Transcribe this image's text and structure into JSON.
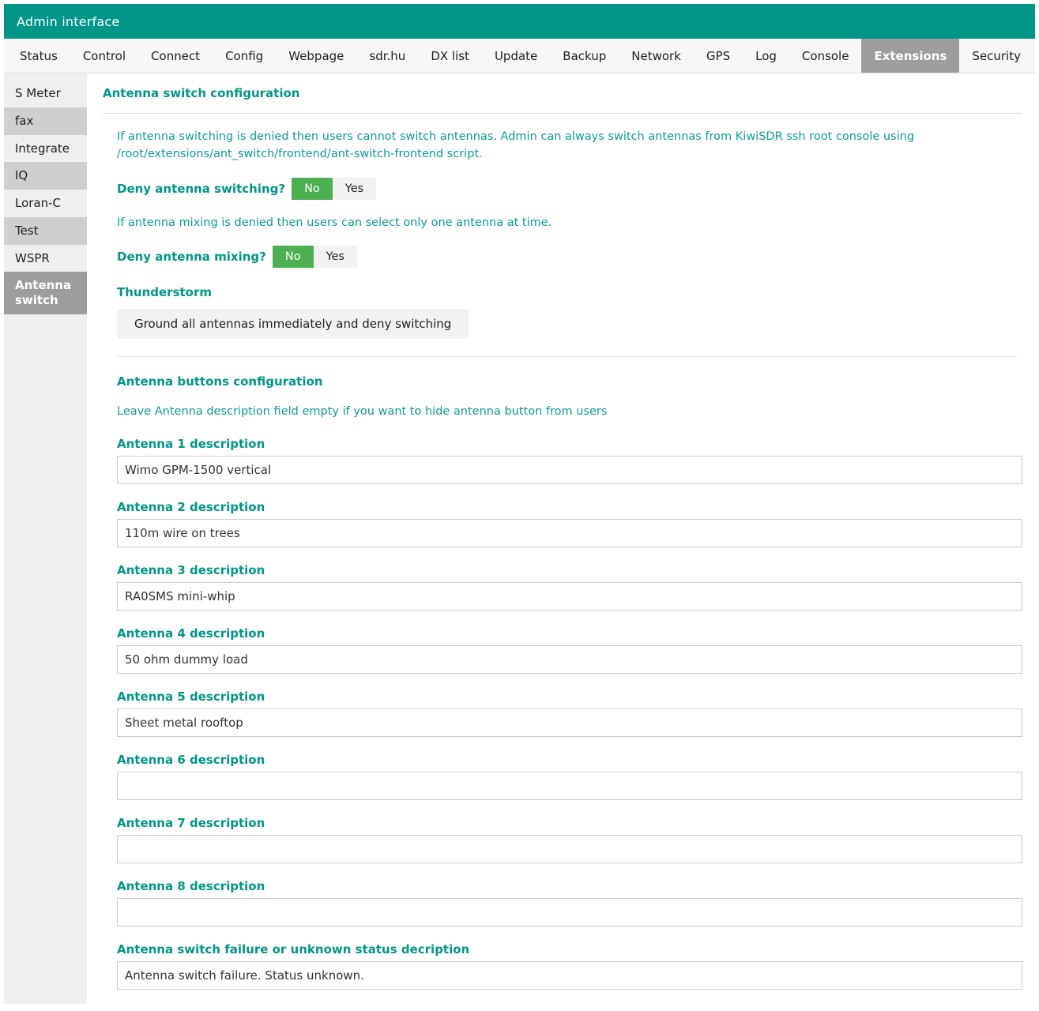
{
  "header": {
    "title": "Admin interface"
  },
  "nav": {
    "tabs": [
      {
        "label": "Status",
        "active": false
      },
      {
        "label": "Control",
        "active": false
      },
      {
        "label": "Connect",
        "active": false
      },
      {
        "label": "Config",
        "active": false
      },
      {
        "label": "Webpage",
        "active": false
      },
      {
        "label": "sdr.hu",
        "active": false
      },
      {
        "label": "DX list",
        "active": false
      },
      {
        "label": "Update",
        "active": false
      },
      {
        "label": "Backup",
        "active": false
      },
      {
        "label": "Network",
        "active": false
      },
      {
        "label": "GPS",
        "active": false
      },
      {
        "label": "Log",
        "active": false
      },
      {
        "label": "Console",
        "active": false
      },
      {
        "label": "Extensions",
        "active": true
      },
      {
        "label": "Security",
        "active": false
      }
    ]
  },
  "sidebar": {
    "items": [
      {
        "label": "S Meter",
        "active": false
      },
      {
        "label": "fax",
        "active": false
      },
      {
        "label": "Integrate",
        "active": false
      },
      {
        "label": "IQ",
        "active": false
      },
      {
        "label": "Loran-C",
        "active": false
      },
      {
        "label": "Test",
        "active": false
      },
      {
        "label": "WSPR",
        "active": false
      },
      {
        "label": "Antenna switch",
        "active": true
      }
    ]
  },
  "main": {
    "title": "Antenna switch configuration",
    "switching_info": "If antenna switching is denied then users cannot switch antennas. Admin can always switch antennas from KiwiSDR ssh root console using /root/extensions/ant_switch/frontend/ant-switch-frontend script.",
    "deny_switching": {
      "label": "Deny antenna switching?",
      "options": [
        {
          "label": "No",
          "selected": true
        },
        {
          "label": "Yes",
          "selected": false
        }
      ]
    },
    "mixing_info": "If antenna mixing is denied then users can select only one antenna at time.",
    "deny_mixing": {
      "label": "Deny antenna mixing?",
      "options": [
        {
          "label": "No",
          "selected": true
        },
        {
          "label": "Yes",
          "selected": false
        }
      ]
    },
    "thunderstorm": {
      "title": "Thunderstorm",
      "button_label": "Ground all antennas immediately and deny switching"
    },
    "buttons_config": {
      "title": "Antenna buttons configuration",
      "hint": "Leave Antenna description field empty if you want to hide antenna button from users",
      "antennas": [
        {
          "label": "Antenna 1 description",
          "value": "Wimo GPM-1500 vertical"
        },
        {
          "label": "Antenna 2 description",
          "value": "110m wire on trees"
        },
        {
          "label": "Antenna 3 description",
          "value": "RA0SMS mini-whip"
        },
        {
          "label": "Antenna 4 description",
          "value": "50 ohm dummy load"
        },
        {
          "label": "Antenna 5 description",
          "value": "Sheet metal rooftop"
        },
        {
          "label": "Antenna 6 description",
          "value": ""
        },
        {
          "label": "Antenna 7 description",
          "value": ""
        },
        {
          "label": "Antenna 8 description",
          "value": ""
        }
      ],
      "failure": {
        "label": "Antenna switch failure or unknown status decription",
        "value": "Antenna switch failure. Status unknown."
      }
    }
  },
  "colors": {
    "brand_teal": "#009688",
    "info_teal": "#0d9a9a",
    "toggle_green": "#4caf50",
    "active_gray": "#9d9d9d",
    "sidebar_bg": "#efefef",
    "sidebar_alt": "#cfcfcf"
  }
}
